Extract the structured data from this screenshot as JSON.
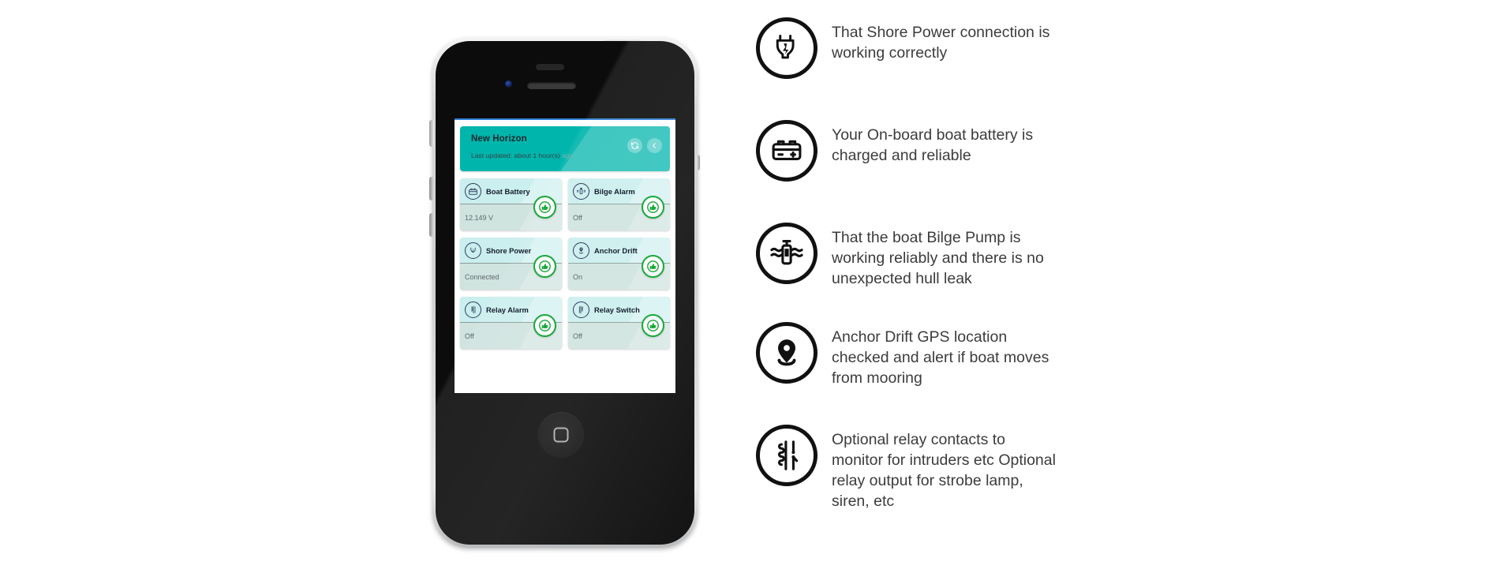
{
  "phone": {
    "hardware": {
      "power_button": "power-button",
      "mute_switch": "mute-switch",
      "volume_up": "volume-up-button",
      "volume_down": "volume-down-button",
      "home_button": "home-button",
      "speaker": "earpiece-speaker",
      "camera": "front-camera",
      "sensor": "proximity-sensor"
    }
  },
  "app": {
    "header": {
      "title": "New Horizon",
      "last_updated_label": "Last updated: about 1 hour(s)",
      "last_updated_suffix": "ago",
      "refresh_icon": "refresh-icon",
      "back_icon": "back-arrow-icon",
      "background_color": "#00b5ac",
      "title_color": "#17282c"
    },
    "cards": [
      {
        "label": "Boat Battery",
        "value": "12.149 V",
        "icon": "boat-battery-icon",
        "status_icon": "thumbs-up-icon",
        "status": "ok"
      },
      {
        "label": "Bilge Alarm",
        "value": "Off",
        "icon": "bilge-alarm-icon",
        "status_icon": "thumbs-up-icon",
        "status": "ok"
      },
      {
        "label": "Shore Power",
        "value": "Connected",
        "icon": "shore-power-icon",
        "status_icon": "thumbs-up-icon",
        "status": "ok"
      },
      {
        "label": "Anchor Drift",
        "value": "On",
        "icon": "anchor-drift-icon",
        "status_icon": "thumbs-up-icon",
        "status": "ok"
      },
      {
        "label": "Relay Alarm",
        "value": "Off",
        "icon": "relay-alarm-icon",
        "status_icon": "thumbs-up-icon",
        "status": "ok"
      },
      {
        "label": "Relay Switch",
        "value": "Off",
        "icon": "relay-switch-icon",
        "status_icon": "thumbs-up-icon",
        "status": "ok"
      }
    ],
    "colors": {
      "card_top": "#cbeeee",
      "card_bottom": "#cfe3df",
      "status_green": "#18a83a",
      "icon_outline": "#2c3c5c"
    }
  },
  "features": [
    {
      "icon": "power-plug-icon",
      "text": "That Shore Power connection is working correctly"
    },
    {
      "icon": "battery-icon",
      "text": "Your On-board boat battery is charged and reliable"
    },
    {
      "icon": "bilge-pump-icon",
      "text": "That the boat Bilge Pump is working reliably and there is no unexpected hull leak"
    },
    {
      "icon": "map-pin-icon",
      "text": "Anchor Drift GPS location checked and alert if boat moves from mooring"
    },
    {
      "icon": "relay-coil-icon",
      "text": "Optional relay contacts to monitor for intruders etc Optional relay output for strobe lamp, siren, etc"
    }
  ]
}
